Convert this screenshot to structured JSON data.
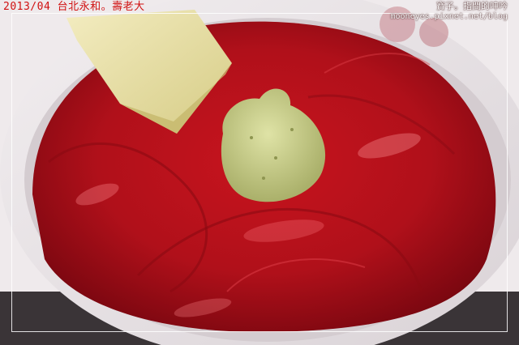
{
  "watermark": {
    "title": "2013/04 台北永和。壽老大",
    "author": "寶子。指間的呻吟",
    "url": "mooneyes.pixnet.net/blog"
  },
  "photo": {
    "subject": "maguro-don-bowl",
    "colors": {
      "tuna": "#b3101a",
      "tuna_dark": "#7a0710",
      "bowl": "#e9e4e6",
      "wasabi": "#c9cf8a",
      "tamagoyaki": "#e8e0a8",
      "caption_red": "#d01010"
    }
  }
}
